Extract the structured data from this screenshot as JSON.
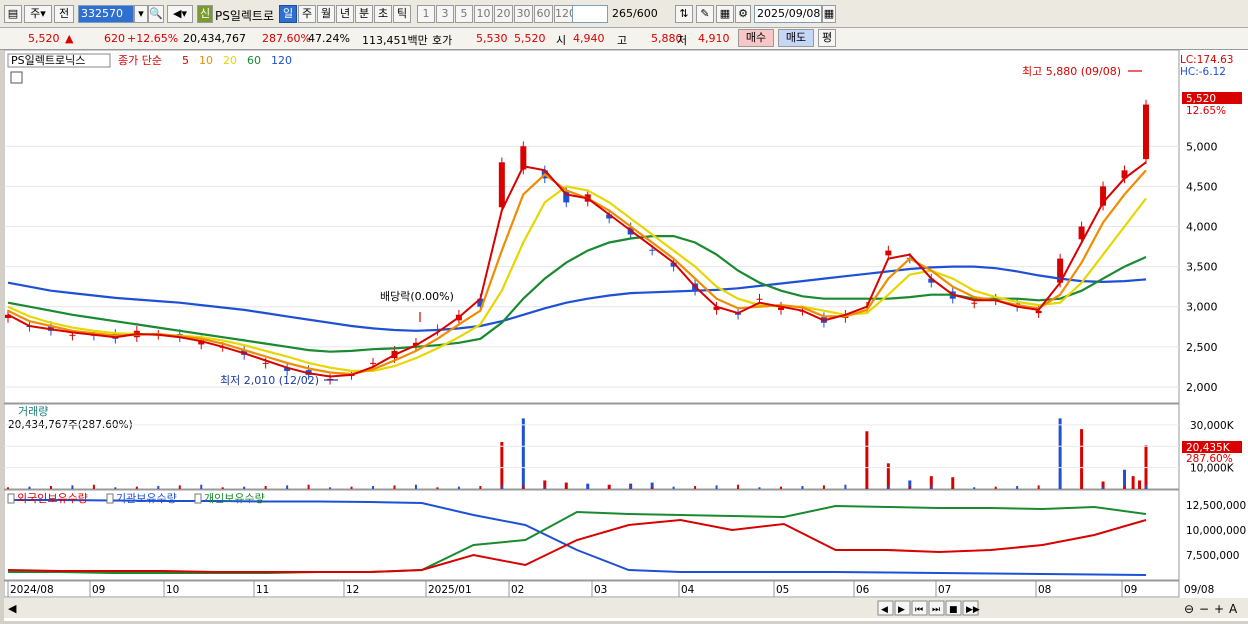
{
  "toolbar": {
    "type_label": "주",
    "prev_label": "전",
    "code": "332570",
    "name": "PS일렉트로",
    "credit_badge": "신",
    "periods": [
      "일",
      "주",
      "월",
      "년",
      "분",
      "초",
      "틱"
    ],
    "period_selected": "일",
    "minutes": [
      "1",
      "3",
      "5",
      "10",
      "20",
      "30",
      "60",
      "120"
    ],
    "bar_count": "265",
    "bar_total": "/600",
    "date": "2025/09/08"
  },
  "quote": {
    "price": "5,520",
    "arrow": "▲",
    "change": "620",
    "change_pct": "+12.65%",
    "volume": "20,434,767",
    "volume_pct": "287.60%",
    "ratio": "47.24%",
    "amount": "113,451백만",
    "hoga_label": "호가",
    "hoga1": "5,530",
    "hoga2": "5,520",
    "open_label": "시",
    "open": "4,940",
    "high_label": "고",
    "high": "5,880",
    "low_label": "저",
    "low": "4,910",
    "buy_label": "매수",
    "sell_label": "매도",
    "eval_label": "평"
  },
  "chart_data": {
    "type": "line",
    "title": "PS일렉트로닉스",
    "legend": {
      "prefix": "종가 단순",
      "ma": [
        "5",
        "10",
        "20",
        "60",
        "120"
      ],
      "ma_colors": [
        "#d90000",
        "#f08c00",
        "#e6d700",
        "#1a8a30",
        "#1e50d6"
      ]
    },
    "y_ticks": [
      "5,000",
      "4,500",
      "4,000",
      "3,500",
      "3,000",
      "2,500",
      "2,000"
    ],
    "ylim": [
      1800,
      6200
    ],
    "lc": "LC:174.63",
    "hc": "HC:-6.12",
    "current_price_tag": "5,520",
    "current_pct_tag": "12.65%",
    "annotations": {
      "high": "최고 5,880 (09/08)",
      "low": "최저 2,010 (12/02)",
      "dividend": "배당락(0.00%)"
    },
    "x_ticks": [
      "2024/08",
      "09",
      "10",
      "11",
      "12",
      "2025/01",
      "02",
      "03",
      "04",
      "05",
      "06",
      "07",
      "08",
      "09"
    ],
    "x_right_label": "09/08",
    "price_points": [
      2900,
      2750,
      2700,
      2650,
      2640,
      2600,
      2700,
      2650,
      2620,
      2580,
      2500,
      2400,
      2300,
      2200,
      2150,
      2100,
      2150,
      2300,
      2450,
      2550,
      2700,
      2900,
      3000,
      4800,
      5000,
      4600,
      4300,
      4400,
      4100,
      3900,
      3700,
      3500,
      3200,
      3000,
      2900,
      3100,
      3000,
      2950,
      2800,
      2900,
      3000,
      3700,
      3600,
      3300,
      3100,
      3050,
      3100,
      3000,
      2950,
      3600,
      4000,
      4500,
      4700,
      5520
    ],
    "ma5": [
      2900,
      2760,
      2720,
      2680,
      2650,
      2620,
      2660,
      2650,
      2620,
      2570,
      2500,
      2420,
      2330,
      2240,
      2170,
      2130,
      2150,
      2250,
      2400,
      2520,
      2680,
      2870,
      3100,
      4200,
      4750,
      4700,
      4400,
      4350,
      4150,
      3950,
      3750,
      3550,
      3250,
      3000,
      2920,
      3050,
      3000,
      2950,
      2830,
      2900,
      3000,
      3600,
      3650,
      3350,
      3150,
      3080,
      3080,
      3000,
      2960,
      3300,
      3800,
      4300,
      4600,
      4800
    ],
    "ma10": [
      2950,
      2820,
      2760,
      2700,
      2670,
      2640,
      2650,
      2660,
      2630,
      2600,
      2540,
      2460,
      2380,
      2300,
      2230,
      2180,
      2160,
      2220,
      2330,
      2450,
      2600,
      2780,
      2950,
      3700,
      4400,
      4650,
      4450,
      4350,
      4200,
      4000,
      3800,
      3600,
      3350,
      3100,
      2980,
      3000,
      3020,
      2990,
      2880,
      2880,
      2960,
      3350,
      3600,
      3450,
      3250,
      3120,
      3080,
      3020,
      2980,
      3150,
      3550,
      4050,
      4400,
      4700
    ],
    "ma20": [
      3000,
      2880,
      2800,
      2740,
      2700,
      2670,
      2660,
      2650,
      2640,
      2620,
      2580,
      2520,
      2450,
      2380,
      2300,
      2240,
      2200,
      2200,
      2260,
      2360,
      2480,
      2620,
      2780,
      3200,
      3800,
      4300,
      4500,
      4450,
      4300,
      4100,
      3900,
      3700,
      3500,
      3250,
      3100,
      3020,
      3000,
      3000,
      2950,
      2900,
      2920,
      3150,
      3400,
      3450,
      3350,
      3200,
      3120,
      3060,
      3020,
      3050,
      3300,
      3650,
      4000,
      4350
    ],
    "ma60": [
      3050,
      3000,
      2950,
      2900,
      2860,
      2820,
      2780,
      2740,
      2700,
      2660,
      2620,
      2580,
      2540,
      2500,
      2460,
      2440,
      2450,
      2470,
      2480,
      2500,
      2520,
      2550,
      2600,
      2800,
      3100,
      3350,
      3550,
      3700,
      3800,
      3850,
      3880,
      3880,
      3800,
      3650,
      3450,
      3300,
      3200,
      3130,
      3100,
      3100,
      3100,
      3100,
      3120,
      3150,
      3150,
      3100,
      3100,
      3100,
      3080,
      3100,
      3200,
      3350,
      3500,
      3620
    ],
    "ma120": [
      3300,
      3250,
      3200,
      3170,
      3140,
      3110,
      3090,
      3070,
      3050,
      3020,
      2990,
      2960,
      2920,
      2880,
      2840,
      2800,
      2760,
      2730,
      2710,
      2700,
      2710,
      2730,
      2760,
      2820,
      2900,
      2980,
      3050,
      3100,
      3140,
      3170,
      3180,
      3190,
      3200,
      3210,
      3230,
      3260,
      3290,
      3320,
      3350,
      3380,
      3410,
      3440,
      3470,
      3490,
      3500,
      3500,
      3480,
      3440,
      3390,
      3350,
      3320,
      3310,
      3320,
      3340
    ],
    "volume_panel": {
      "title": "거래량",
      "summary": "20,434,767주(287.60%)",
      "ticks": [
        "30,000K",
        "20,000K",
        "10,000K"
      ],
      "tag": "20,435K",
      "tag_pct": "287.60%",
      "spike_values_k": [
        22000,
        33000,
        4000,
        3000,
        2500,
        2000,
        2500,
        3000,
        27000,
        12000,
        4000,
        6000,
        5500,
        33000,
        28000,
        3500,
        9000,
        6000,
        4000,
        5000,
        20435
      ]
    },
    "holdings_panel": {
      "series": [
        "외국인보유수량",
        "기관보유수량",
        "개인보유수량"
      ],
      "series_colors": [
        "#d90000",
        "#1e50d6",
        "#1a8a30"
      ],
      "ticks": [
        "12,500,000",
        "10,000,000",
        "7,500,000"
      ]
    }
  },
  "bottom": {
    "nav_buttons": [
      "◀",
      "▶",
      "⏮",
      "⏭",
      "■",
      "▶▶"
    ],
    "tools": [
      "⊖",
      "−",
      "+",
      "A"
    ]
  }
}
